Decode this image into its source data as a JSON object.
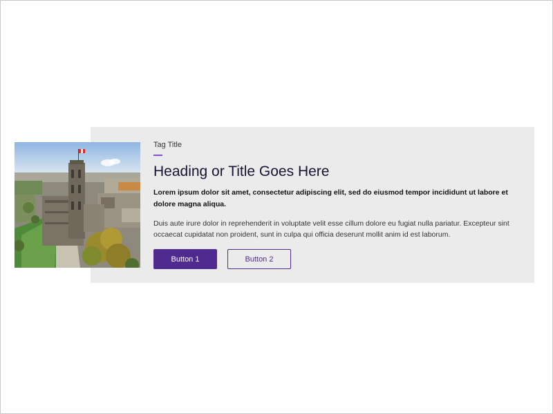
{
  "card": {
    "tag": "Tag Title",
    "heading": "Heading or Title Goes Here",
    "lead": "Lorem ipsum dolor sit amet, consectetur adipiscing elit, sed do eiusmod tempor incididunt ut labore et dolore magna aliqua.",
    "body": "Duis aute irure dolor in reprehenderit in voluptate velit esse cillum dolore eu fugiat nulla pariatur. Excepteur sint occaecat cupidatat non proident, sunt in culpa qui officia deserunt mollit anim id est laborum.",
    "button_primary": "Button 1",
    "button_secondary": "Button 2"
  },
  "colors": {
    "accent": "#4f2a8f",
    "tag_rule": "#7b52c7",
    "card_background": "#ebebeb",
    "heading": "#1a1233"
  },
  "image": {
    "subject": "campus-building-aerial-photo"
  }
}
